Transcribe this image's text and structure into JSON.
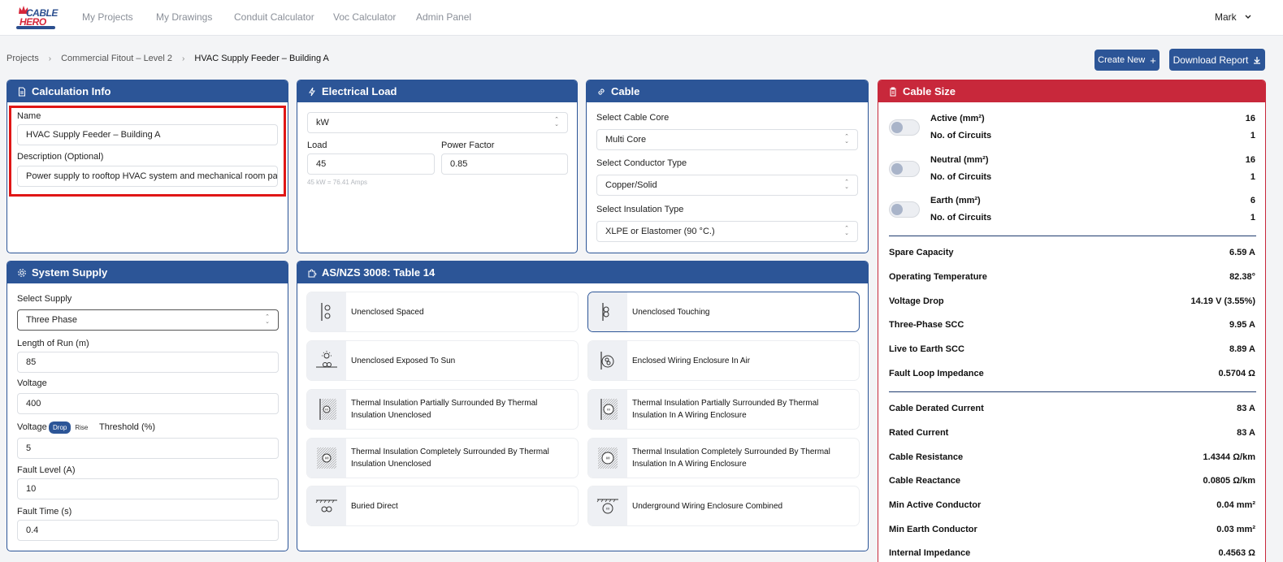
{
  "brand": {
    "logo_text_1": "CABLE",
    "logo_text_2": "HERO"
  },
  "nav": {
    "items": [
      "My Projects",
      "My Drawings",
      "Conduit Calculator",
      "Voc Calculator",
      "Admin Panel"
    ],
    "user": "Mark"
  },
  "breadcrumb": [
    "Projects",
    "Commercial Fitout – Level 2",
    "HVAC Supply Feeder – Building A"
  ],
  "actions": {
    "create_new": "Create New",
    "download_report": "Download Report"
  },
  "calc_info": {
    "title": "Calculation Info",
    "name_label": "Name",
    "name_value": "HVAC Supply Feeder – Building A",
    "desc_label": "Description (Optional)",
    "desc_value": "Power supply to rooftop HVAC system and mechanical room panel;"
  },
  "electrical_load": {
    "title": "Electrical Load",
    "unit": "kW",
    "load_label": "Load",
    "load_value": "45",
    "pf_label": "Power Factor",
    "pf_value": "0.85",
    "hint": "45 kW = 76.41 Amps"
  },
  "cable": {
    "title": "Cable",
    "core_label": "Select Cable Core",
    "core_value": "Multi Core",
    "conductor_label": "Select Conductor Type",
    "conductor_value": "Copper/Solid",
    "insulation_label": "Select Insulation Type",
    "insulation_value": "XLPE or Elastomer (90 °C.)"
  },
  "system_supply": {
    "title": "System Supply",
    "supply_label": "Select Supply",
    "supply_value": "Three Phase",
    "length_label": "Length of Run (m)",
    "length_value": "85",
    "voltage_label": "Voltage",
    "voltage_value": "400",
    "vd_label_pre": "Voltage",
    "vd_toggle_on": "Drop",
    "vd_toggle_off": "Rise",
    "vd_label_post": "Threshold (%)",
    "threshold_value": "5",
    "fault_level_label": "Fault Level (A)",
    "fault_level_value": "10",
    "fault_time_label": "Fault Time (s)",
    "fault_time_value": "0.4"
  },
  "table14": {
    "title": "AS/NZS 3008: Table 14",
    "methods": [
      {
        "label": "Unenclosed Spaced",
        "icon": "spaced-icon",
        "selected": false
      },
      {
        "label": "Unenclosed Touching",
        "icon": "touching-icon",
        "selected": true
      },
      {
        "label": "Unenclosed Exposed To Sun",
        "icon": "sun-icon",
        "selected": false
      },
      {
        "label": "Enclosed Wiring Enclosure In Air",
        "icon": "enclosure-air-icon",
        "selected": false
      },
      {
        "label": "Thermal Insulation Partially Surrounded By Thermal Insulation Unenclosed",
        "icon": "thermal-partial-icon",
        "selected": false
      },
      {
        "label": "Thermal Insulation Partially Surrounded By Thermal Insulation In A Wiring Enclosure",
        "icon": "thermal-partial-enclosure-icon",
        "selected": false
      },
      {
        "label": "Thermal Insulation Completely Surrounded By Thermal Insulation Unenclosed",
        "icon": "thermal-complete-icon",
        "selected": false
      },
      {
        "label": "Thermal Insulation Completely Surrounded By Thermal Insulation In A Wiring Enclosure",
        "icon": "thermal-complete-enclosure-icon",
        "selected": false
      },
      {
        "label": "Buried Direct",
        "icon": "buried-icon",
        "selected": false
      },
      {
        "label": "Underground Wiring Enclosure Combined",
        "icon": "underground-icon",
        "selected": false
      }
    ]
  },
  "cable_size": {
    "title": "Cable Size",
    "conductors": [
      {
        "label": "Active (mm²)",
        "value": "16",
        "circuits_label": "No. of Circuits",
        "circuits": "1"
      },
      {
        "label": "Neutral (mm²)",
        "value": "16",
        "circuits_label": "No. of Circuits",
        "circuits": "1"
      },
      {
        "label": "Earth (mm²)",
        "value": "6",
        "circuits_label": "No. of Circuits",
        "circuits": "1"
      }
    ],
    "group1": [
      {
        "label": "Spare Capacity",
        "value": "6.59 A"
      },
      {
        "label": "Operating Temperature",
        "value": "82.38°"
      },
      {
        "label": "Voltage Drop",
        "value": "14.19 V (3.55%)"
      },
      {
        "label": "Three-Phase SCC",
        "value": "9.95 A"
      },
      {
        "label": "Live to Earth SCC",
        "value": "8.89 A"
      },
      {
        "label": "Fault Loop Impedance",
        "value": "0.5704 Ω"
      }
    ],
    "group2": [
      {
        "label": "Cable Derated Current",
        "value": "83 A"
      },
      {
        "label": "Rated Current",
        "value": "83 A"
      },
      {
        "label": "Cable Resistance",
        "value": "1.4344 Ω/km"
      },
      {
        "label": "Cable Reactance",
        "value": "0.0805 Ω/km"
      },
      {
        "label": "Min Active Conductor",
        "value": "0.04 mm²"
      },
      {
        "label": "Min Earth Conductor",
        "value": "0.03 mm²"
      },
      {
        "label": "Internal Impedance",
        "value": "0.4563 Ω"
      }
    ]
  },
  "colors": {
    "primary": "#2c5597",
    "danger": "#c8283b",
    "highlight": "#e01616"
  }
}
